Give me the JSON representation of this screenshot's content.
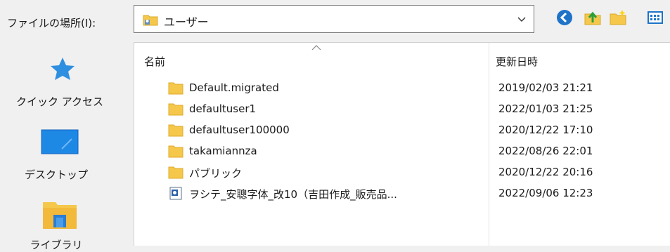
{
  "location": {
    "label": "ファイルの場所(I):",
    "current": "ユーザー"
  },
  "toolbar": {
    "buttons": [
      "back-icon",
      "up-folder-icon",
      "new-folder-icon",
      "view-menu-icon"
    ]
  },
  "nav": {
    "items": [
      {
        "label": "クイック アクセス",
        "icon": "quick-access-star-icon"
      },
      {
        "label": "デスクトップ",
        "icon": "desktop-icon"
      },
      {
        "label": "ライブラリ",
        "icon": "library-icon"
      }
    ]
  },
  "columns": {
    "name": "名前",
    "modified": "更新日時"
  },
  "files": [
    {
      "name": "Default.migrated",
      "date": "2019/02/03 21:21",
      "type": "folder"
    },
    {
      "name": "defaultuser1",
      "date": "2022/01/03 21:25",
      "type": "folder"
    },
    {
      "name": "defaultuser100000",
      "date": "2020/12/22 17:10",
      "type": "folder"
    },
    {
      "name": "takamiannza",
      "date": "2022/08/26 22:01",
      "type": "folder"
    },
    {
      "name": "パブリック",
      "date": "2020/12/22 20:16",
      "type": "folder"
    },
    {
      "name": "ヲシテ_安聰字体_改10（吉田作成_販売品...",
      "date": "2022/09/06 12:23",
      "type": "shortcut"
    }
  ],
  "colors": {
    "folder": "#f5c84c",
    "folder_dark": "#e0a82a",
    "accent_blue": "#1e88e5"
  }
}
